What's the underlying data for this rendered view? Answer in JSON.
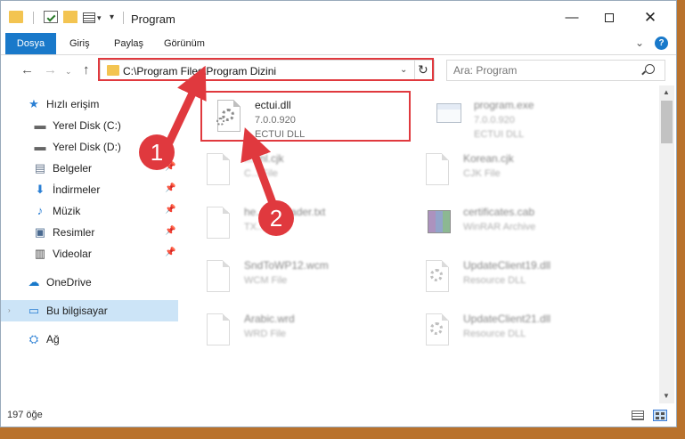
{
  "titlebar": {
    "title": "Program",
    "minimize_glyph": "—",
    "close_glyph": "✕",
    "dropdown_glyph": "▾",
    "pin_glyph": "▾"
  },
  "ribbon": {
    "tabs": [
      "Dosya",
      "Giriş",
      "Paylaş",
      "Görünüm"
    ],
    "expand_glyph": "⌄",
    "help_glyph": "?"
  },
  "nav": {
    "back_glyph": "←",
    "forward_glyph": "→",
    "dropdown_glyph": "⌄",
    "up_glyph": "↑"
  },
  "address": {
    "path": "C:\\Program Files\\Program Dizini",
    "dropdown_glyph": "⌄",
    "refresh_glyph": "↻"
  },
  "search": {
    "placeholder": "Ara: Program"
  },
  "sidebar": {
    "items": [
      {
        "label": "Hızlı erişim",
        "icon": "star-icon",
        "glyph": "★"
      },
      {
        "label": "Yerel Disk (C:)",
        "icon": "drive-icon",
        "glyph": "▬"
      },
      {
        "label": "Yerel Disk (D:)",
        "icon": "drive-icon",
        "glyph": "▬"
      },
      {
        "label": "Belgeler",
        "icon": "documents-icon",
        "glyph": "▤"
      },
      {
        "label": "İndirmeler",
        "icon": "download-icon",
        "glyph": "⬇"
      },
      {
        "label": "Müzik",
        "icon": "music-icon",
        "glyph": "♪"
      },
      {
        "label": "Resimler",
        "icon": "pictures-icon",
        "glyph": "▣"
      },
      {
        "label": "Videolar",
        "icon": "videos-icon",
        "glyph": "▥"
      },
      {
        "label": "OneDrive",
        "icon": "cloud-icon",
        "glyph": "☁"
      },
      {
        "label": "Bu bilgisayar",
        "icon": "computer-icon",
        "glyph": "▭"
      },
      {
        "label": "Ağ",
        "icon": "network-icon",
        "glyph": "⛭"
      }
    ],
    "pin_glyph": "📌",
    "expand_glyph": "›"
  },
  "files": [
    {
      "name": "ectui.dll",
      "line1": "7.0.0.920",
      "line2": "ECTUI DLL",
      "icon": "dll-icon"
    },
    {
      "name": "program.exe",
      "line1": "7.0.0.920",
      "line2": "ECTUI DLL",
      "icon": "exe-icon"
    },
    {
      "name": "Korean.cjk",
      "line1": "CJK File",
      "line2": "",
      "icon": "file-icon"
    },
    {
      "name": "certificates.cab",
      "line1": "WinRAR Archive",
      "line2": "",
      "icon": "archive-icon"
    },
    {
      "name": "SndToWP12.wcm",
      "line1": "WCM File",
      "line2": "",
      "icon": "file-icon"
    },
    {
      "name": "UpdateClient19.dll",
      "line1": "Resource DLL",
      "line2": "",
      "icon": "dll-icon"
    },
    {
      "name": "Arabic.wrd",
      "line1": "WRD File",
      "line2": "",
      "icon": "file-icon"
    },
    {
      "name": "UpdateClient21.dll",
      "line1": "Resource DLL",
      "line2": "",
      "icon": "dll-icon"
    },
    {
      "name": "...rml.cjk",
      "line1": "C... File",
      "line2": "",
      "icon": "file-icon"
    },
    {
      "name": "he... ...Reader.txt",
      "line1": "TX...",
      "line2": "",
      "icon": "file-icon"
    }
  ],
  "scrollbar": {
    "up_glyph": "▲",
    "down_glyph": "▼",
    "position_fraction": 0.0
  },
  "status": {
    "count": "197 öğe"
  },
  "callouts": {
    "one": "1",
    "two": "2",
    "color": "#e0393e"
  },
  "colors": {
    "accent": "#1979ca",
    "highlight": "#e0393e",
    "folder": "#f3c451",
    "selected": "#cce4f7"
  }
}
